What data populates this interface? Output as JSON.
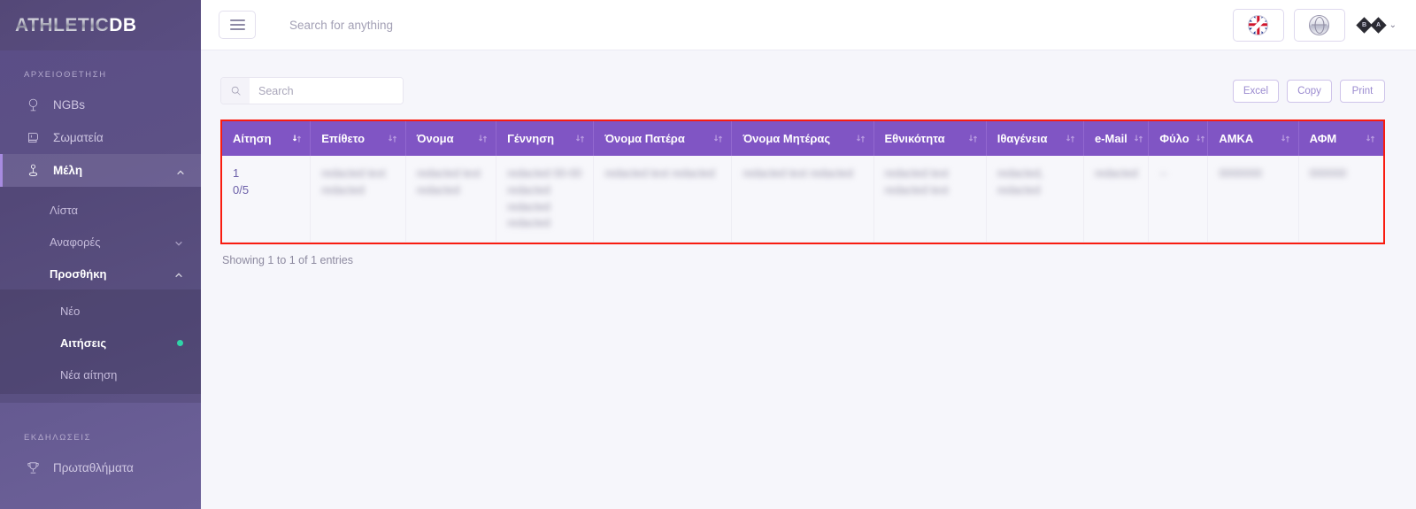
{
  "sidebar": {
    "logo": {
      "part1": "ATHLETIC",
      "part2": "DB"
    },
    "sections": [
      {
        "title": "ΑΡΧΕΙΟΘΕΤΗΣΗ",
        "items": [
          {
            "label": "NGBs",
            "icon": "globe-icon",
            "active": false,
            "expandable": false
          },
          {
            "label": "Σωματεία",
            "icon": "boxing-glove-icon",
            "active": false,
            "expandable": false
          },
          {
            "label": "Μέλη",
            "icon": "member-icon",
            "active": true,
            "expandable": true,
            "chevron": "up"
          }
        ],
        "submenu": [
          {
            "label": "Λίστα",
            "active": false,
            "expandable": false
          },
          {
            "label": "Αναφορές",
            "active": false,
            "expandable": true,
            "chevron": "down"
          },
          {
            "label": "Προσθήκη",
            "active": true,
            "expandable": true,
            "chevron": "up"
          }
        ],
        "subsubmenu": [
          {
            "label": "Νέο",
            "active": false,
            "badge": false
          },
          {
            "label": "Αιτήσεις",
            "active": true,
            "badge": true
          },
          {
            "label": "Νέα αίτηση",
            "active": false,
            "badge": false
          }
        ]
      },
      {
        "title": "ΕΚΔΗΛΩΣΕΙΣ",
        "items": [
          {
            "label": "Πρωταθλήματα",
            "icon": "trophy-icon",
            "active": false,
            "expandable": false
          }
        ]
      }
    ]
  },
  "topbar": {
    "menu_toggle": "hamburger-icon",
    "search_placeholder": "Search for anything",
    "search_value": "",
    "language_flag": "uk-flag-icon",
    "globe": "globe-icon",
    "avatar_caret": "⌄"
  },
  "toolbar": {
    "search_placeholder": "Search",
    "search_value": "",
    "buttons": [
      {
        "label": "Excel"
      },
      {
        "label": "Copy"
      },
      {
        "label": "Print"
      }
    ]
  },
  "table": {
    "columns": [
      {
        "label": "Αίτηση",
        "sortable": true,
        "sorted": "asc"
      },
      {
        "label": "Επίθετο",
        "sortable": true,
        "sorted": "none"
      },
      {
        "label": "Όνομα",
        "sortable": true,
        "sorted": "none"
      },
      {
        "label": "Γέννηση",
        "sortable": true,
        "sorted": "none"
      },
      {
        "label": "Όνομα Πατέρα",
        "sortable": true,
        "sorted": "none"
      },
      {
        "label": "Όνομα Μητέρας",
        "sortable": true,
        "sorted": "none"
      },
      {
        "label": "Εθνικότητα",
        "sortable": true,
        "sorted": "none"
      },
      {
        "label": "Ιθαγένεια",
        "sortable": true,
        "sorted": "none"
      },
      {
        "label": "e-Mail",
        "sortable": true,
        "sorted": "none"
      },
      {
        "label": "Φύλο",
        "sortable": true,
        "sorted": "none"
      },
      {
        "label": "ΑΜΚΑ",
        "sortable": true,
        "sorted": "none"
      },
      {
        "label": "ΑΦΜ",
        "sortable": true,
        "sorted": "none"
      }
    ],
    "rows": [
      {
        "application_id": "1",
        "application_progress": "0/5",
        "last_name": "redacted text\nredacted",
        "first_name": "redacted text\nredacted",
        "birth": "redacted 00-00\nredacted redacted\nredacted",
        "father_name": "redacted text\nredacted",
        "mother_name": "redacted text\nredacted",
        "ethnicity": "redacted text\nredacted text",
        "citizenship": "redacted,\nredacted",
        "email": "redacted",
        "gender": "--",
        "amka": "0000000",
        "afm": "000000"
      }
    ],
    "footer": "Showing 1 to 1 of 1 entries",
    "highlight_color": "#f91c10",
    "header_color": "#8055c4"
  }
}
